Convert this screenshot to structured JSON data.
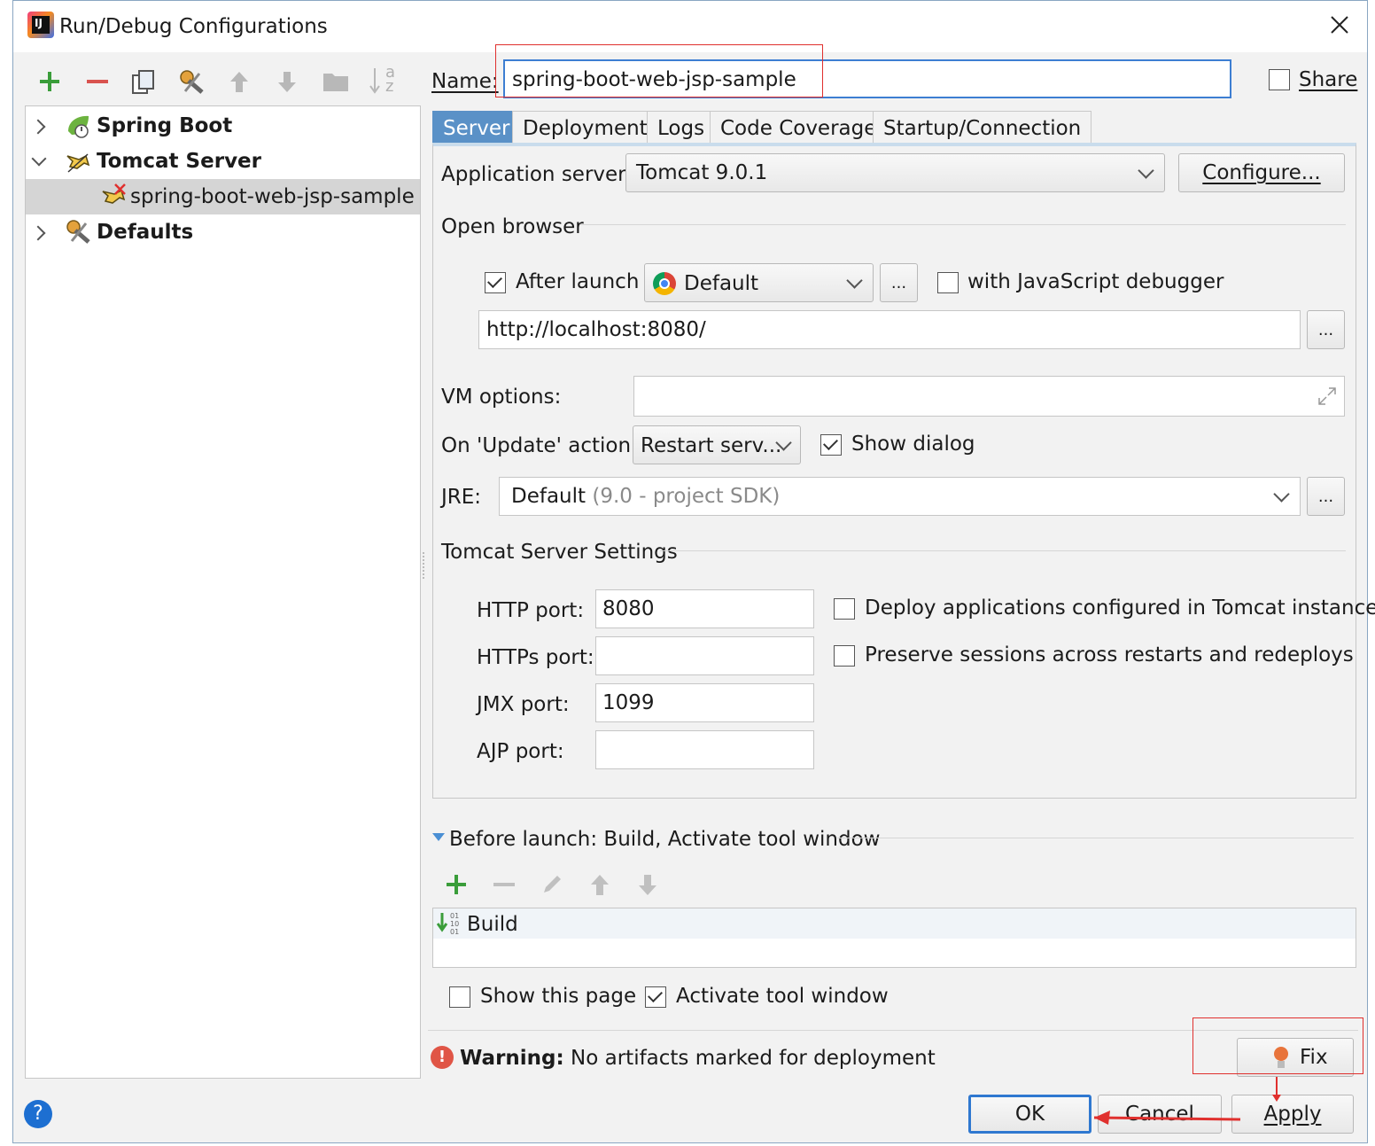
{
  "window": {
    "title": "Run/Debug Configurations"
  },
  "toolbar": {
    "sort_glyph_top": "a",
    "sort_glyph_bottom": "z"
  },
  "tree": {
    "items": [
      {
        "label": "Spring Boot"
      },
      {
        "label": "Tomcat Server"
      },
      {
        "label": "spring-boot-web-jsp-sample"
      },
      {
        "label": "Defaults"
      }
    ]
  },
  "name_row": {
    "label": "Name:",
    "value": "spring-boot-web-jsp-sample",
    "share_label": "Share"
  },
  "tabs": [
    {
      "label": "Server"
    },
    {
      "label": "Deployment"
    },
    {
      "label": "Logs"
    },
    {
      "label": "Code Coverage"
    },
    {
      "label": "Startup/Connection"
    }
  ],
  "server": {
    "app_server_label": "Application server:",
    "app_server_value": "Tomcat 9.0.1",
    "configure_label": "Configure...",
    "open_browser_label": "Open browser",
    "after_launch_label": "After launch",
    "browser_value": "Default",
    "browse_dots": "...",
    "js_debugger_label": "with JavaScript debugger",
    "url_value": "http://localhost:8080/",
    "vm_options_label": "VM options:",
    "vm_options_value": "",
    "update_action_label": "On 'Update' action:",
    "update_action_value": "Restart serv...",
    "show_dialog_label": "Show dialog",
    "jre_label": "JRE:",
    "jre_value": "Default",
    "jre_hint": "(9.0 - project SDK)",
    "tomcat_settings_label": "Tomcat Server Settings",
    "http_port_label": "HTTP port:",
    "http_port_value": "8080",
    "https_port_label": "HTTPs port:",
    "https_port_value": "",
    "jmx_port_label": "JMX port:",
    "jmx_port_value": "1099",
    "ajp_port_label": "AJP port:",
    "ajp_port_value": "",
    "deploy_apps_label": "Deploy applications configured in Tomcat instance",
    "preserve_sessions_label": "Preserve sessions across restarts and redeploys"
  },
  "before_launch": {
    "header": "Before launch: Build, Activate tool window",
    "items": [
      {
        "label": "Build"
      }
    ],
    "show_page_label": "Show this page",
    "activate_tool_label": "Activate tool window"
  },
  "warning": {
    "bold": "Warning:",
    "text": "No artifacts marked for deployment",
    "fix_label": "Fix"
  },
  "buttons": {
    "ok": "OK",
    "cancel": "Cancel",
    "apply": "Apply",
    "help": "?"
  },
  "colors": {
    "accent": "#5a91c7",
    "focus_border": "#3d7ed2",
    "annotation_red": "#e0302e",
    "green_add": "#3a9d3a"
  },
  "state": {
    "share_checked": false,
    "after_launch_checked": true,
    "js_debugger_checked": false,
    "show_dialog_checked": true,
    "deploy_apps_checked": false,
    "preserve_sessions_checked": false,
    "show_page_checked": false,
    "activate_tool_checked": true
  }
}
